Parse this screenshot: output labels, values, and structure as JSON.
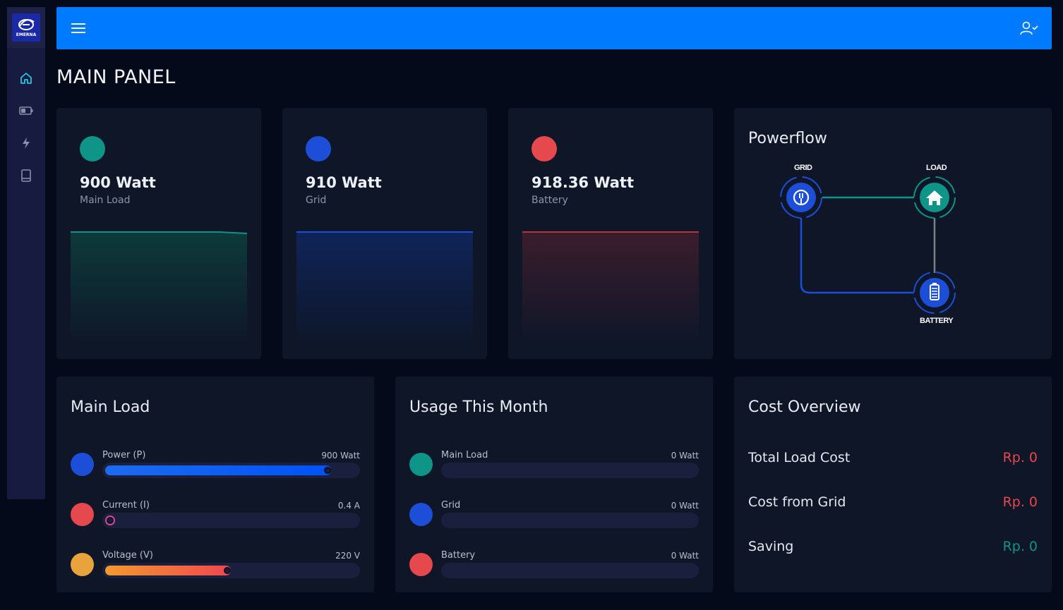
{
  "app": {
    "logo_text": "EMERNA"
  },
  "sidebar": {
    "items": [
      {
        "icon": "home-icon",
        "active": true
      },
      {
        "icon": "battery-icon",
        "active": false
      },
      {
        "icon": "bolt-icon",
        "active": false
      },
      {
        "icon": "book-icon",
        "active": false
      }
    ]
  },
  "header": {
    "menu_icon": "hamburger-icon",
    "user_icon": "user-check-icon"
  },
  "page": {
    "title": "MAIN PANEL"
  },
  "stats": [
    {
      "value": "900 Watt",
      "label": "Main Load",
      "color": "#0f9488",
      "fill_level": 1.0
    },
    {
      "value": "910 Watt",
      "label": "Grid",
      "color": "#1d4ed8",
      "fill_level": 1.0
    },
    {
      "value": "918.36 Watt",
      "label": "Battery",
      "color": "#e5484d",
      "fill_level": 1.0
    }
  ],
  "powerflow": {
    "title": "Powerflow",
    "nodes": {
      "grid": "GRID",
      "load": "LOAD",
      "battery": "BATTERY"
    }
  },
  "main_load": {
    "title": "Main Load",
    "rows": [
      {
        "label": "Power (P)",
        "value": "900 Watt",
        "color": "#1d4ed8",
        "level": 0.88
      },
      {
        "label": "Current (I)",
        "value": "0.4 A",
        "color": "#e5484d",
        "level": 0.02
      },
      {
        "label": "Voltage (V)",
        "value": "220 V",
        "color": "#e8a33c",
        "level": 0.48
      }
    ]
  },
  "usage": {
    "title": "Usage This Month",
    "rows": [
      {
        "label": "Main Load",
        "value": "0 Watt",
        "color": "#0f9488"
      },
      {
        "label": "Grid",
        "value": "0 Watt",
        "color": "#1d4ed8"
      },
      {
        "label": "Battery",
        "value": "0 Watt",
        "color": "#e5484d"
      }
    ]
  },
  "cost": {
    "title": "Cost Overview",
    "rows": [
      {
        "label": "Total Load Cost",
        "value": "Rp. 0",
        "color": "#e5484d"
      },
      {
        "label": "Cost from Grid",
        "value": "Rp. 0",
        "color": "#e5484d"
      },
      {
        "label": "Saving",
        "value": "Rp. 0",
        "color": "#0f9488"
      }
    ]
  }
}
